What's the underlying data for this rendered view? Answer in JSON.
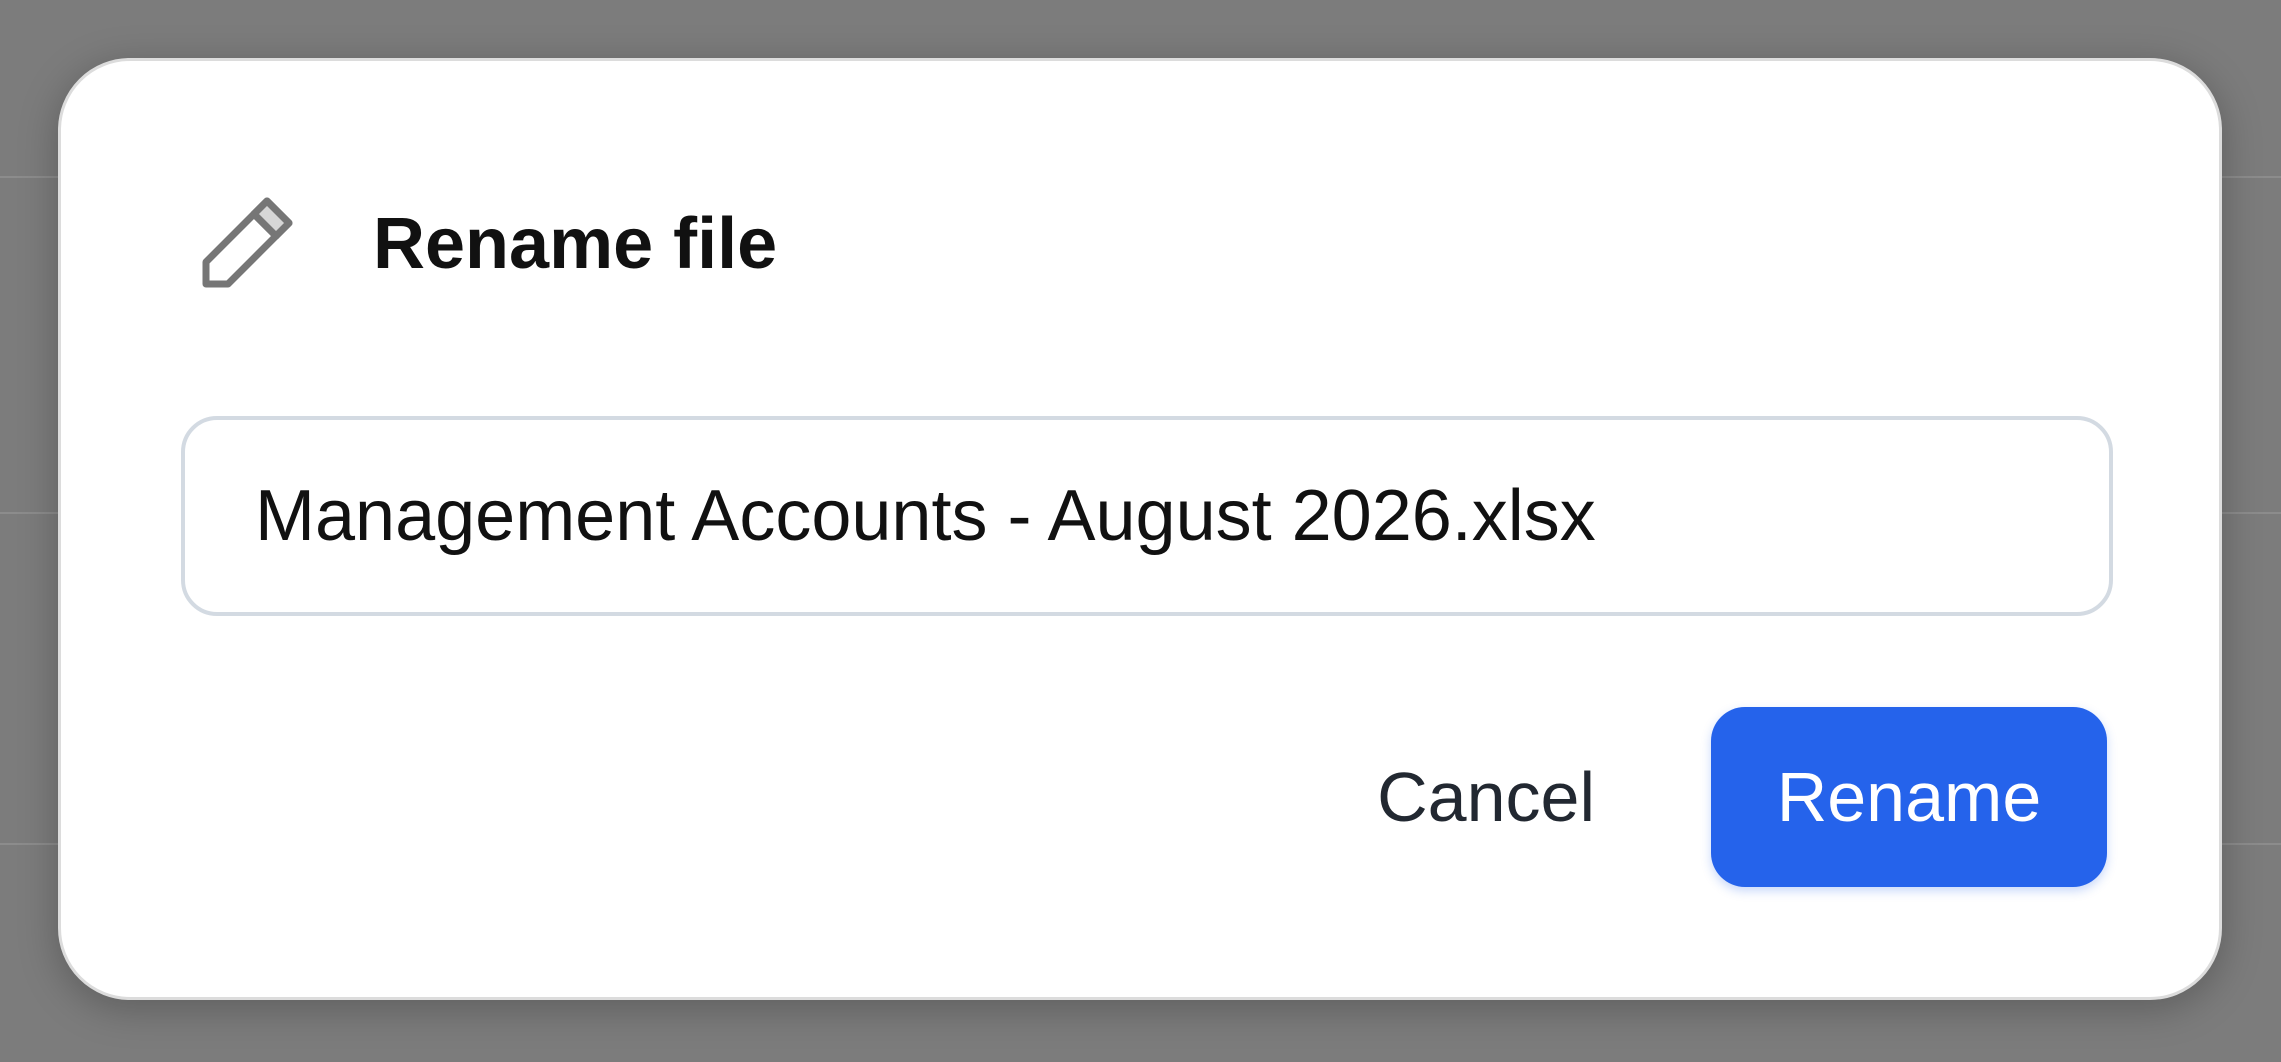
{
  "dialog": {
    "title": "Rename file",
    "icon": "pencil-icon",
    "filename_value": "Management Accounts - August 2026.xlsx",
    "cancel_label": "Cancel",
    "rename_label": "Rename"
  },
  "colors": {
    "primary": "#2563eb",
    "backdrop": "#7c7c7c",
    "input_border": "#d3dae2"
  }
}
